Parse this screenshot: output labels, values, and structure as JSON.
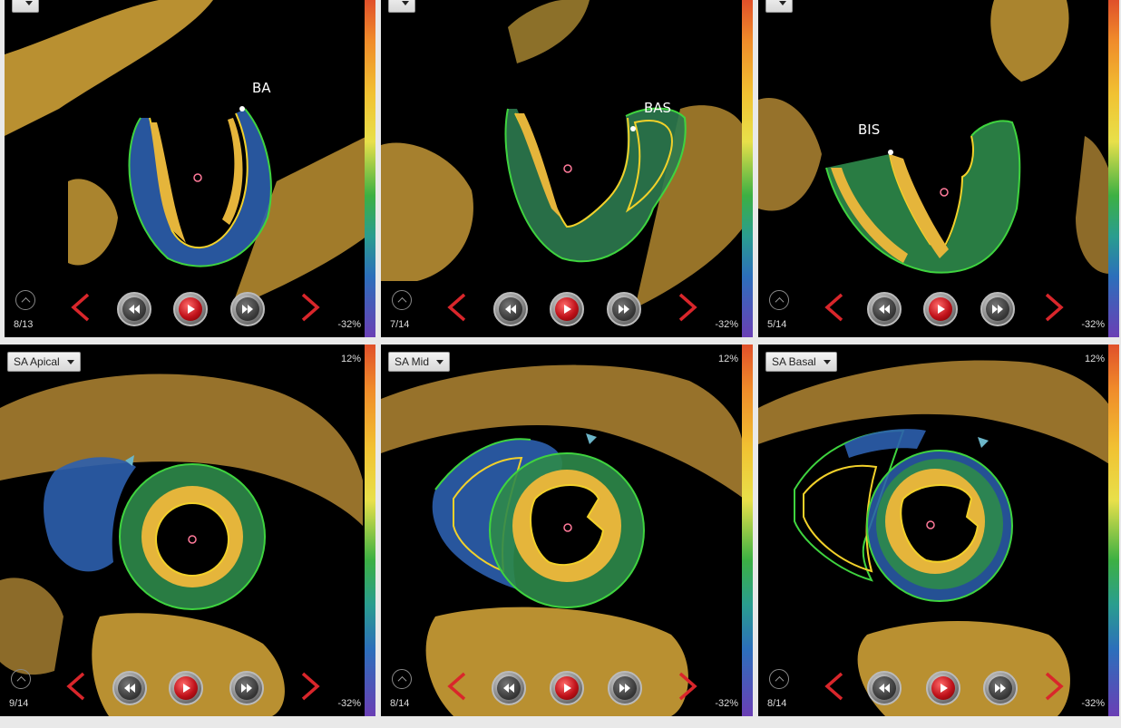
{
  "panels": [
    {
      "view_label": "",
      "frame": "8/13",
      "scale_top": "",
      "scale_bottom": "-32%",
      "annotation": "BA"
    },
    {
      "view_label": "",
      "frame": "7/14",
      "scale_top": "",
      "scale_bottom": "-32%",
      "annotation": "BAS"
    },
    {
      "view_label": "",
      "frame": "5/14",
      "scale_top": "",
      "scale_bottom": "-32%",
      "annotation": "BIS"
    },
    {
      "view_label": "SA Apical",
      "frame": "9/14",
      "scale_top": "12%",
      "scale_bottom": "-32%",
      "annotation": ""
    },
    {
      "view_label": "SA Mid",
      "frame": "8/14",
      "scale_top": "12%",
      "scale_bottom": "-32%",
      "annotation": ""
    },
    {
      "view_label": "SA Basal",
      "frame": "8/14",
      "scale_top": "12%",
      "scale_bottom": "-32%",
      "annotation": ""
    }
  ],
  "colors": {
    "endocardial_contour": "#f2d12a",
    "epicardial_contour": "#3fd43f",
    "tissue": "#e5b53b",
    "nav_arrow": "#d9262b"
  },
  "icons": {
    "prev": "chevron-left-icon",
    "next": "chevron-right-icon",
    "rewind": "rewind-icon",
    "play": "play-icon",
    "fast_forward": "fast-forward-icon",
    "up": "chevron-up-icon"
  }
}
